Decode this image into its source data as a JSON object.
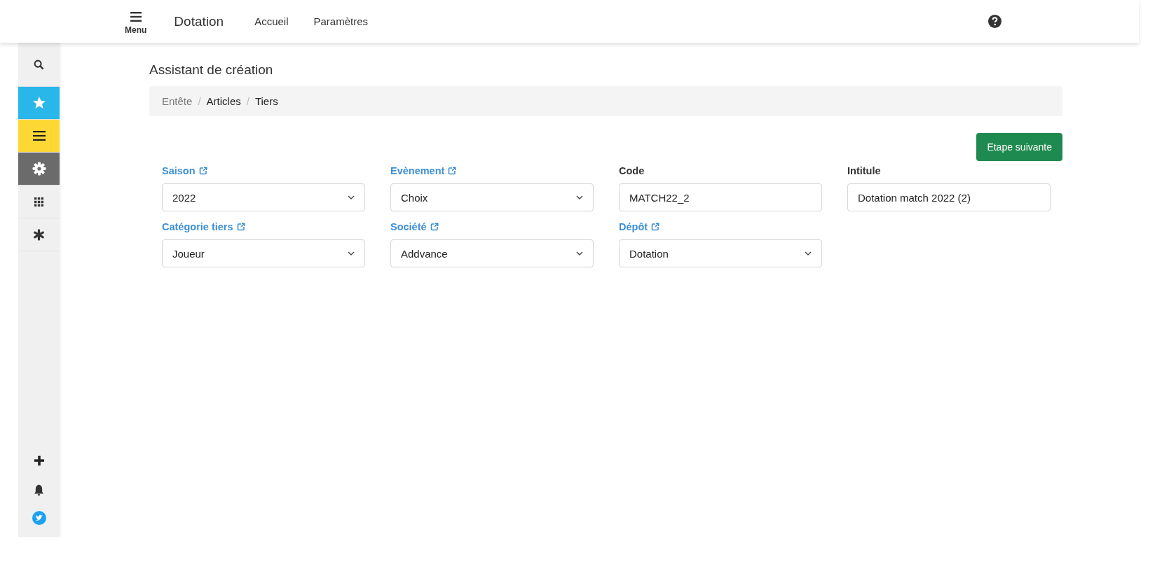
{
  "topbar": {
    "menu_label": "Menu",
    "app_title": "Dotation",
    "nav": [
      {
        "label": "Accueil"
      },
      {
        "label": "Paramètres"
      }
    ]
  },
  "sidebar": {
    "top_items": [
      {
        "kind": "search",
        "color": "#f0f0f0"
      },
      {
        "kind": "star",
        "color": "#29b6e8"
      },
      {
        "kind": "lines",
        "color": "#fdd835"
      },
      {
        "kind": "gear",
        "color": "#6b6b6b"
      },
      {
        "kind": "grid",
        "color": "#f0f0f0"
      },
      {
        "kind": "asterisk",
        "color": "#f0f0f0"
      }
    ],
    "bottom_items": [
      {
        "kind": "plus"
      },
      {
        "kind": "bell"
      },
      {
        "kind": "bird"
      }
    ]
  },
  "page_title": "Assistant de création",
  "breadcrumb": [
    {
      "label": "Entête",
      "disabled": true
    },
    {
      "label": "Articles",
      "disabled": false
    },
    {
      "label": "Tiers",
      "disabled": false
    }
  ],
  "breadcrumb_separator": "/",
  "next_button": "Etape suivante",
  "fields": [
    {
      "label": "Saison",
      "linked": true,
      "kind": "select",
      "value": "2022"
    },
    {
      "label": "Evènement",
      "linked": true,
      "kind": "select",
      "value": "Choix"
    },
    {
      "label": "Code",
      "linked": false,
      "kind": "text",
      "value": "MATCH22_2"
    },
    {
      "label": "Intitule",
      "linked": false,
      "kind": "text",
      "value": "Dotation match 2022 (2)"
    },
    {
      "label": "Catégorie tiers",
      "linked": true,
      "kind": "select",
      "value": "Joueur"
    },
    {
      "label": "Société",
      "linked": true,
      "kind": "select",
      "value": "Addvance"
    },
    {
      "label": "Dépôt",
      "linked": true,
      "kind": "select",
      "value": "Dotation"
    }
  ]
}
